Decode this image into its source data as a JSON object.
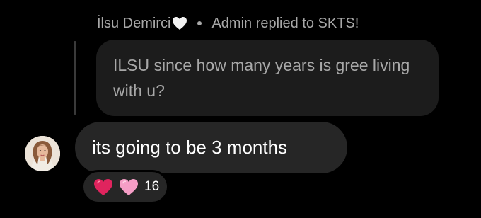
{
  "reply": {
    "sender_name": "İlsu Demirci",
    "sender_emoji": "white-heart",
    "separator": "•",
    "context": "Admin replied to SKTS!"
  },
  "quoted_message": {
    "text": "ILSU since how many years is gree living with u?"
  },
  "message": {
    "text": "its going to be 3 months",
    "avatar": "user-avatar"
  },
  "reactions": {
    "emojis": [
      "red-heart",
      "pink-heart"
    ],
    "count": "16"
  },
  "colors": {
    "background": "#000000",
    "quoted_bubble": "#1c1c1c",
    "message_bubble": "#262626",
    "muted_text": "#a8a8a8",
    "text": "#ffffff",
    "red_heart": "#e0245e",
    "pink_heart": "#f59ec6"
  }
}
